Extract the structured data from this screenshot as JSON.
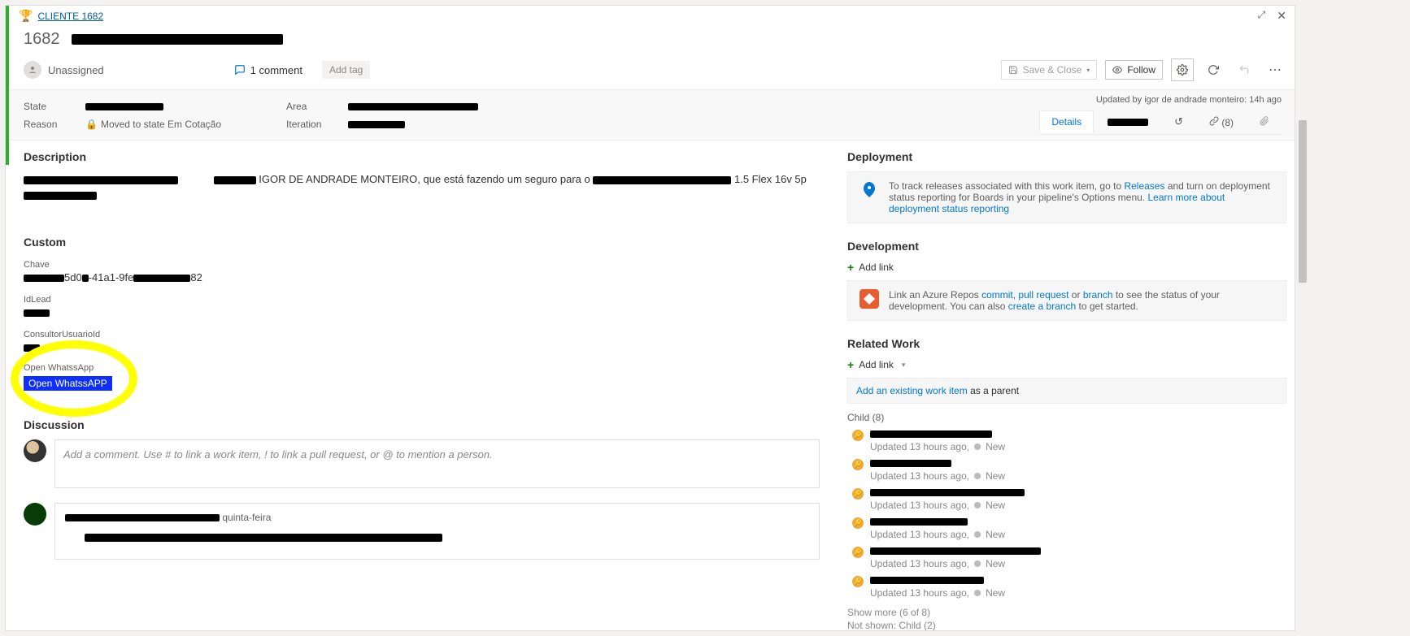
{
  "breadcrumb": {
    "label": "CLIENTE 1682"
  },
  "window": {
    "maximize_title": "Maximize",
    "close_title": "Close"
  },
  "work_item": {
    "id": "1682",
    "title": "████████████████████████████",
    "assignee": "Unassigned",
    "comments": {
      "count": "1 comment"
    },
    "add_tag": "Add tag"
  },
  "toolbar": {
    "save_close": "Save & Close",
    "follow": "Follow",
    "settings_title": "Customize",
    "refresh_title": "Refresh",
    "undo_title": "Revert changes",
    "more_title": "More actions"
  },
  "meta": {
    "state_label": "State",
    "state_value": "████████████",
    "reason_label": "Reason",
    "reason_value": "Moved to state Em Cotação",
    "area_label": "Area",
    "area_value": "████████████████████████",
    "iteration_label": "Iteration",
    "iteration_value": "██████████",
    "updated_by": "Updated by igor de andrade monteiro: 14h ago"
  },
  "tabs": {
    "details": "Details",
    "second": "████████",
    "history_title": "History",
    "links_label": "(8)",
    "attachments_title": "Attachments"
  },
  "description": {
    "heading": "Description",
    "text_visible_fragment": "IGOR DE ANDRADE MONTEIRO, que está fazendo um seguro para o",
    "text_tail_fragment": "1.5 Flex 16v 5p"
  },
  "custom": {
    "heading": "Custom",
    "chave_label": "Chave",
    "chave_value_mid": "5d0",
    "chave_value_mid2": "41a1-9fe",
    "chave_value_end": "82",
    "idlead_label": "IdLead",
    "consultor_label": "ConsultorUsuarioId",
    "open_wa_label": "Open WhatssApp",
    "open_wa_button": "Open WhatssAPP"
  },
  "discussion": {
    "heading": "Discussion",
    "placeholder": "Add a comment. Use # to link a work item, ! to link a pull request, or @ to mention a person.",
    "entry_time": "quinta-feira"
  },
  "deployment": {
    "heading": "Deployment",
    "text_pre": "To track releases associated with this work item, go to ",
    "link1": "Releases",
    "text_mid": " and turn on deployment status reporting for Boards in your pipeline's Options menu. ",
    "link2": "Learn more about deployment status reporting"
  },
  "development": {
    "heading": "Development",
    "addlink": "Add link",
    "text_pre": "Link an Azure Repos ",
    "link_commit": "commit",
    "sep1": ", ",
    "link_pr": "pull request",
    "sep2": " or ",
    "link_branch": "branch",
    "text_mid": " to see the status of your development. You can also ",
    "link_create": "create a branch",
    "text_post": " to get started."
  },
  "related": {
    "heading": "Related Work",
    "addlink": "Add link",
    "parent_pre": "Add an existing work item",
    "parent_post": " as a parent",
    "child_head": "Child (8)",
    "items": [
      {
        "sub": "Updated 13 hours ago,",
        "state": "New"
      },
      {
        "sub": "Updated 13 hours ago,",
        "state": "New"
      },
      {
        "sub": "Updated 13 hours ago,",
        "state": "New"
      },
      {
        "sub": "Updated 13 hours ago,",
        "state": "New"
      },
      {
        "sub": "Updated 13 hours ago,",
        "state": "New"
      },
      {
        "sub": "Updated 13 hours ago,",
        "state": "New"
      }
    ],
    "showmore": "Show more",
    "showmore_count": "(6 of 8)",
    "notshown": "Not shown: Child (2)"
  }
}
